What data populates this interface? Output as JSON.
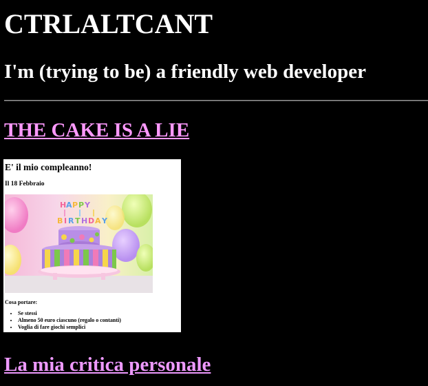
{
  "header": {
    "site_title": "CTRLALTCANT",
    "tagline": "I'm (trying to be) a friendly web developer"
  },
  "posts": [
    {
      "title": "THE CAKE IS A LIE",
      "preview": {
        "heading": "E' il mio compleanno!",
        "date_line": "Il 18 Febbraio",
        "image": "birthday-cake-photo",
        "image_banner_text": "HAPPY BIRTHDAY",
        "bring_label": "Cosa portare:",
        "bring_items": [
          "Se stessi",
          "Almeno 50 euro ciascuno (regalo o contanti)",
          "Voglia di fare giochi semplici"
        ]
      }
    },
    {
      "title": "La mia critica personale"
    }
  ],
  "colors": {
    "background": "#000000",
    "text": "#ffffff",
    "link": "#ff99ff",
    "link_visited": "#ee99ff",
    "divider": "#9a9a9a"
  }
}
